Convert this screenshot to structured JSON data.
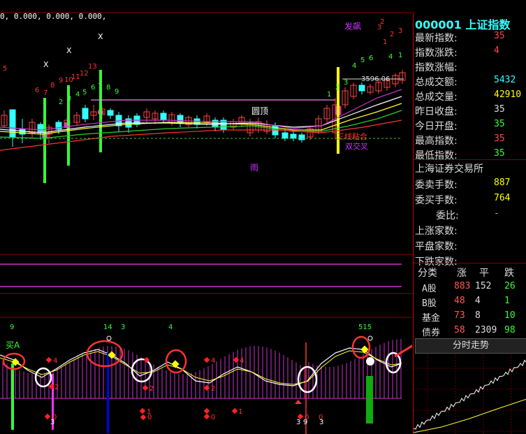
{
  "header": {
    "indicator_values": "0, 0.000, 0.000, 0.000,"
  },
  "annotations": {
    "fabiao": "发飙",
    "yuanding": "圆顶",
    "tiaojian": "三线粘合",
    "shuangjiaocha": "双交叉",
    "yu": "雨",
    "price_tag": "3596.06",
    "maia": "买A"
  },
  "candle_numbers": [
    "5",
    "6",
    "7",
    "8",
    "9",
    "10",
    "11",
    "12",
    "13",
    "2",
    "3",
    "4",
    "5",
    "6",
    "7",
    "8",
    "9",
    "1",
    "2",
    "3",
    "4",
    "5",
    "6",
    "1",
    "2",
    "3",
    "4",
    "1",
    "2",
    "3"
  ],
  "x_marks": [
    "X",
    "X",
    "X"
  ],
  "lower_numbers": {
    "n9": "9",
    "n14": "14",
    "n3a": "3",
    "n4": "4",
    "n515": "515",
    "b3a": "3",
    "b3b": "3",
    "b9": "9",
    "b3c": "3",
    "d4a": "4",
    "d4b": "4",
    "d4c": "4",
    "d2a": "2",
    "d2b": "2",
    "d2c": "2",
    "d1a": "1",
    "d1b": "1",
    "d0a": "0",
    "d0b": "0",
    "d0c": "0",
    "d0d": "0",
    "d0e": "0"
  },
  "panel": {
    "title": "000001 上证指数",
    "rows": [
      {
        "label": "最新指数:",
        "value": "35",
        "color": "#ff4444"
      },
      {
        "label": "指数涨跌:",
        "value": "4",
        "color": "#ff4444"
      },
      {
        "label": "指数涨幅:",
        "value": "",
        "color": "#ff4444"
      },
      {
        "label": "总成交额:",
        "value": "5432",
        "color": "#3ff"
      },
      {
        "label": "总成交量:",
        "value": "42910",
        "color": "#ffff00"
      },
      {
        "label": "昨日收盘:",
        "value": "35",
        "color": "#ddd"
      },
      {
        "label": "今日开盘:",
        "value": "35",
        "color": "#3f3"
      },
      {
        "label": "最高指数:",
        "value": "35",
        "color": "#ff4444"
      },
      {
        "label": "最低指数:",
        "value": "35",
        "color": "#3f3"
      }
    ],
    "exchange": "上海证券交易所",
    "rows2": [
      {
        "label": "委卖手数:",
        "value": "887",
        "color": "#ffff00"
      },
      {
        "label": "委买手数:",
        "value": "764",
        "color": "#ffff00"
      },
      {
        "label": "委比:",
        "value": "-",
        "color": "#3f3"
      },
      {
        "label": "上涨家数:",
        "value": "",
        "color": "#ff4444"
      },
      {
        "label": "平盘家数:",
        "value": "",
        "color": "#ddd"
      },
      {
        "label": "下跌家数:",
        "value": "",
        "color": "#3f3"
      }
    ],
    "grid_headers": [
      "分类",
      "涨",
      "平",
      "跌"
    ],
    "grid_rows": [
      {
        "name": "A股",
        "up": "883",
        "flat": "152",
        "down": "26"
      },
      {
        "name": "B股",
        "up": "48",
        "flat": "4",
        "down": "1"
      },
      {
        "name": "基金",
        "up": "73",
        "flat": "8",
        "down": "10"
      },
      {
        "name": "债券",
        "up": "58",
        "flat": "2309",
        "down": "98"
      }
    ],
    "tab_label": "分时走势"
  }
}
